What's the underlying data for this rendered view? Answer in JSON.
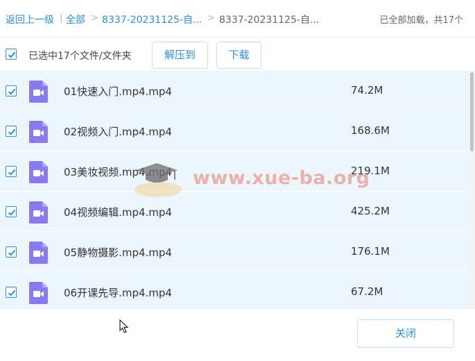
{
  "breadcrumb": {
    "back": "返回上一级",
    "sep1": "|",
    "all": "全部",
    "sep2": ">",
    "folder": "8337-20231125-自...",
    "sep3": ">",
    "current": "8337-20231125-自..."
  },
  "status": "已全部加载，共17个",
  "toolbar": {
    "select_all_checked": true,
    "selected_text": "已选中17个文件/文件夹",
    "extract_label": "解压到",
    "download_label": "下载"
  },
  "files": [
    {
      "name": "01快速入门.mp4.mp4",
      "size": "74.2M",
      "checked": true
    },
    {
      "name": "02视频入门.mp4.mp4",
      "size": "168.6M",
      "checked": true
    },
    {
      "name": "03美妆视频.mp4.mp4",
      "size": "219.1M",
      "checked": true
    },
    {
      "name": "04视频编辑.mp4.mp4",
      "size": "425.2M",
      "checked": true
    },
    {
      "name": "05静物摄影.mp4.mp4",
      "size": "176.1M",
      "checked": true
    },
    {
      "name": "06开课先导.mp4.mp4",
      "size": "67.2M",
      "checked": true
    }
  ],
  "watermark": "www.xue-ba.org",
  "footer": {
    "close_label": "关闭"
  },
  "colors": {
    "accent": "#2d8ed8",
    "row_bg": "#eef6fd",
    "video_icon": "#8a7af0"
  },
  "icons": {
    "file": "video-file-icon",
    "check": "check-icon"
  }
}
